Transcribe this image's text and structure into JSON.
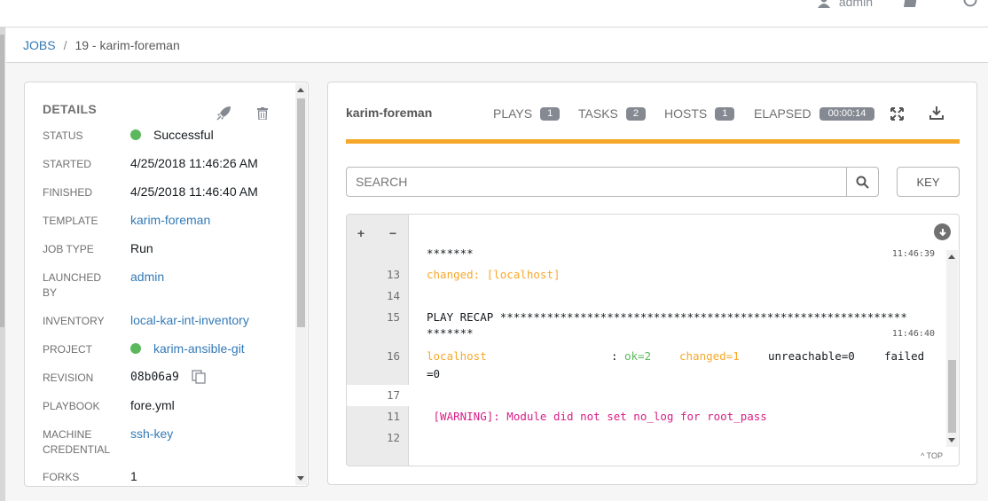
{
  "topbar": {
    "user": "admin",
    "user_icon": "user-icon",
    "docs_icon": "book-icon",
    "logout_icon": "power-icon"
  },
  "breadcrumb": {
    "jobs": "JOBS",
    "separator": "/",
    "current": "19 - karim-foreman"
  },
  "details": {
    "title": "DETAILS",
    "launch_icon": "rocket-icon",
    "delete_icon": "trash-icon",
    "rows": {
      "status": {
        "label": "STATUS",
        "value": "Successful",
        "status_color": "#5cb85c"
      },
      "started": {
        "label": "STARTED",
        "value": "4/25/2018 11:46:26 AM"
      },
      "finished": {
        "label": "FINISHED",
        "value": "4/25/2018 11:46:40 AM"
      },
      "template": {
        "label": "TEMPLATE",
        "value": "karim-foreman"
      },
      "job_type": {
        "label": "JOB TYPE",
        "value": "Run"
      },
      "launched_by": {
        "label": "LAUNCHED BY",
        "value": "admin"
      },
      "inventory": {
        "label": "INVENTORY",
        "value": "local-kar-int-inventory"
      },
      "project": {
        "label": "PROJECT",
        "value": "karim-ansible-git",
        "status_color": "#5cb85c"
      },
      "revision": {
        "label": "REVISION",
        "value": "08b06a9"
      },
      "playbook": {
        "label": "PLAYBOOK",
        "value": "fore.yml"
      },
      "machine_credential": {
        "label": "MACHINE CREDENTIAL",
        "value": "ssh-key"
      },
      "forks": {
        "label": "FORKS",
        "value": "1"
      }
    }
  },
  "output": {
    "job_name": "karim-foreman",
    "plays": {
      "label": "PLAYS",
      "count": "1"
    },
    "tasks": {
      "label": "TASKS",
      "count": "2"
    },
    "hosts": {
      "label": "HOSTS",
      "count": "1"
    },
    "elapsed": {
      "label": "ELAPSED",
      "value": "00:00:14"
    },
    "accent_color": "#f7a82a",
    "search_placeholder": "SEARCH",
    "key_label": "KEY",
    "top_label": "^ TOP",
    "lines": {
      "l0": {
        "num": "",
        "text": "*******",
        "ts": "11:46:39"
      },
      "l13": {
        "num": "13",
        "text": "changed: [localhost]"
      },
      "l14": {
        "num": "14",
        "text": ""
      },
      "l15": {
        "num": "15",
        "text": "PLAY RECAP *************************************************************",
        "ts": "11:46:40"
      },
      "l15b": {
        "text": "*******"
      },
      "l16": {
        "num": "16",
        "host": "localhost",
        "colon": ": ",
        "ok": "ok=2",
        "changed": "changed=1",
        "unreachable": "unreachable=0",
        "failed": "failed",
        "failed_val": "=0"
      },
      "l17": {
        "num": "17",
        "text": ""
      },
      "l11": {
        "num": "11",
        "text": " [WARNING]: Module did not set no_log for root_pass"
      },
      "l12": {
        "num": "12",
        "text": ""
      }
    }
  }
}
